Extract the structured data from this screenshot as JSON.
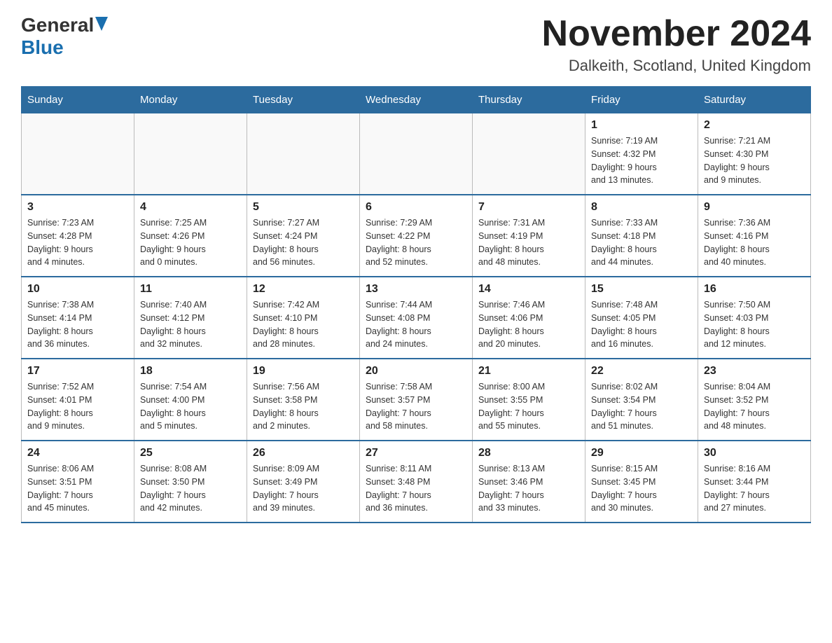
{
  "header": {
    "logo_general": "General",
    "logo_blue": "Blue",
    "month_title": "November 2024",
    "subtitle": "Dalkeith, Scotland, United Kingdom"
  },
  "weekdays": [
    "Sunday",
    "Monday",
    "Tuesday",
    "Wednesday",
    "Thursday",
    "Friday",
    "Saturday"
  ],
  "weeks": [
    [
      {
        "day": "",
        "info": ""
      },
      {
        "day": "",
        "info": ""
      },
      {
        "day": "",
        "info": ""
      },
      {
        "day": "",
        "info": ""
      },
      {
        "day": "",
        "info": ""
      },
      {
        "day": "1",
        "info": "Sunrise: 7:19 AM\nSunset: 4:32 PM\nDaylight: 9 hours\nand 13 minutes."
      },
      {
        "day": "2",
        "info": "Sunrise: 7:21 AM\nSunset: 4:30 PM\nDaylight: 9 hours\nand 9 minutes."
      }
    ],
    [
      {
        "day": "3",
        "info": "Sunrise: 7:23 AM\nSunset: 4:28 PM\nDaylight: 9 hours\nand 4 minutes."
      },
      {
        "day": "4",
        "info": "Sunrise: 7:25 AM\nSunset: 4:26 PM\nDaylight: 9 hours\nand 0 minutes."
      },
      {
        "day": "5",
        "info": "Sunrise: 7:27 AM\nSunset: 4:24 PM\nDaylight: 8 hours\nand 56 minutes."
      },
      {
        "day": "6",
        "info": "Sunrise: 7:29 AM\nSunset: 4:22 PM\nDaylight: 8 hours\nand 52 minutes."
      },
      {
        "day": "7",
        "info": "Sunrise: 7:31 AM\nSunset: 4:19 PM\nDaylight: 8 hours\nand 48 minutes."
      },
      {
        "day": "8",
        "info": "Sunrise: 7:33 AM\nSunset: 4:18 PM\nDaylight: 8 hours\nand 44 minutes."
      },
      {
        "day": "9",
        "info": "Sunrise: 7:36 AM\nSunset: 4:16 PM\nDaylight: 8 hours\nand 40 minutes."
      }
    ],
    [
      {
        "day": "10",
        "info": "Sunrise: 7:38 AM\nSunset: 4:14 PM\nDaylight: 8 hours\nand 36 minutes."
      },
      {
        "day": "11",
        "info": "Sunrise: 7:40 AM\nSunset: 4:12 PM\nDaylight: 8 hours\nand 32 minutes."
      },
      {
        "day": "12",
        "info": "Sunrise: 7:42 AM\nSunset: 4:10 PM\nDaylight: 8 hours\nand 28 minutes."
      },
      {
        "day": "13",
        "info": "Sunrise: 7:44 AM\nSunset: 4:08 PM\nDaylight: 8 hours\nand 24 minutes."
      },
      {
        "day": "14",
        "info": "Sunrise: 7:46 AM\nSunset: 4:06 PM\nDaylight: 8 hours\nand 20 minutes."
      },
      {
        "day": "15",
        "info": "Sunrise: 7:48 AM\nSunset: 4:05 PM\nDaylight: 8 hours\nand 16 minutes."
      },
      {
        "day": "16",
        "info": "Sunrise: 7:50 AM\nSunset: 4:03 PM\nDaylight: 8 hours\nand 12 minutes."
      }
    ],
    [
      {
        "day": "17",
        "info": "Sunrise: 7:52 AM\nSunset: 4:01 PM\nDaylight: 8 hours\nand 9 minutes."
      },
      {
        "day": "18",
        "info": "Sunrise: 7:54 AM\nSunset: 4:00 PM\nDaylight: 8 hours\nand 5 minutes."
      },
      {
        "day": "19",
        "info": "Sunrise: 7:56 AM\nSunset: 3:58 PM\nDaylight: 8 hours\nand 2 minutes."
      },
      {
        "day": "20",
        "info": "Sunrise: 7:58 AM\nSunset: 3:57 PM\nDaylight: 7 hours\nand 58 minutes."
      },
      {
        "day": "21",
        "info": "Sunrise: 8:00 AM\nSunset: 3:55 PM\nDaylight: 7 hours\nand 55 minutes."
      },
      {
        "day": "22",
        "info": "Sunrise: 8:02 AM\nSunset: 3:54 PM\nDaylight: 7 hours\nand 51 minutes."
      },
      {
        "day": "23",
        "info": "Sunrise: 8:04 AM\nSunset: 3:52 PM\nDaylight: 7 hours\nand 48 minutes."
      }
    ],
    [
      {
        "day": "24",
        "info": "Sunrise: 8:06 AM\nSunset: 3:51 PM\nDaylight: 7 hours\nand 45 minutes."
      },
      {
        "day": "25",
        "info": "Sunrise: 8:08 AM\nSunset: 3:50 PM\nDaylight: 7 hours\nand 42 minutes."
      },
      {
        "day": "26",
        "info": "Sunrise: 8:09 AM\nSunset: 3:49 PM\nDaylight: 7 hours\nand 39 minutes."
      },
      {
        "day": "27",
        "info": "Sunrise: 8:11 AM\nSunset: 3:48 PM\nDaylight: 7 hours\nand 36 minutes."
      },
      {
        "day": "28",
        "info": "Sunrise: 8:13 AM\nSunset: 3:46 PM\nDaylight: 7 hours\nand 33 minutes."
      },
      {
        "day": "29",
        "info": "Sunrise: 8:15 AM\nSunset: 3:45 PM\nDaylight: 7 hours\nand 30 minutes."
      },
      {
        "day": "30",
        "info": "Sunrise: 8:16 AM\nSunset: 3:44 PM\nDaylight: 7 hours\nand 27 minutes."
      }
    ]
  ]
}
